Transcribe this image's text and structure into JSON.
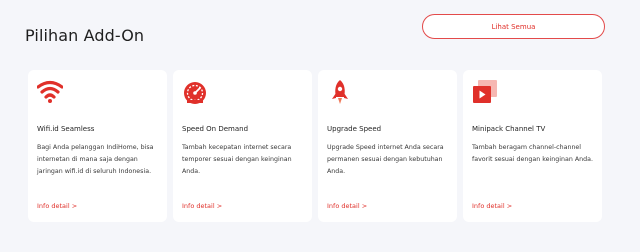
{
  "header": {
    "title": "Pilihan Add-On",
    "see_all_label": "Lihat Semua"
  },
  "colors": {
    "accent": "#e0302a",
    "background": "#f5f6fa",
    "card": "#ffffff"
  },
  "cards": [
    {
      "icon": "wifi-icon",
      "title": "Wifi.id Seamless",
      "description": "Bagi Anda pelanggan IndiHome, bisa internetan di mana saja dengan jaringan wifi.id di seluruh Indonesia.",
      "link": "Info detail >"
    },
    {
      "icon": "speedometer-icon",
      "title": "Speed On Demand",
      "description": "Tambah kecepatan internet secara temporer sesuai dengan keinginan Anda.",
      "link": "Info detail >"
    },
    {
      "icon": "rocket-icon",
      "title": "Upgrade Speed",
      "description": "Upgrade Speed internet Anda secara permanen sesuai dengan kebutuhan Anda.",
      "link": "Info detail >"
    },
    {
      "icon": "play-stack-icon",
      "title": "Minipack Channel TV",
      "description": "Tambah beragam channel-channel favorit sesuai dengan keinginan Anda.",
      "link": "Info detail >"
    }
  ]
}
